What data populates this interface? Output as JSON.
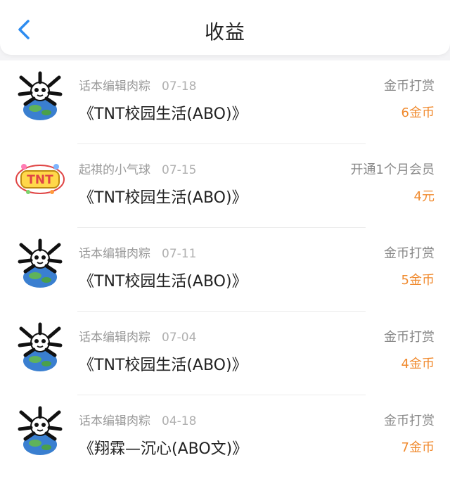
{
  "header": {
    "title": "收益",
    "back_icon": "chevron-left-icon",
    "accent": "#2d8cf0"
  },
  "colors": {
    "amount": "#f08a2e"
  },
  "rows": [
    {
      "user": "话本编辑肉粽",
      "date": "07-18",
      "book": "《TNT校园生活(ABO)》",
      "type": "金币打赏",
      "amount": "6金币",
      "avatar": "panda-globe-avatar"
    },
    {
      "user": "起祺的小气球",
      "date": "07-15",
      "book": "《TNT校园生活(ABO)》",
      "type": "开通1个月会员",
      "amount": "4元",
      "avatar": "tnt-sticker-avatar"
    },
    {
      "user": "话本编辑肉粽",
      "date": "07-11",
      "book": "《TNT校园生活(ABO)》",
      "type": "金币打赏",
      "amount": "5金币",
      "avatar": "panda-globe-avatar"
    },
    {
      "user": "话本编辑肉粽",
      "date": "07-04",
      "book": "《TNT校园生活(ABO)》",
      "type": "金币打赏",
      "amount": "4金币",
      "avatar": "panda-globe-avatar"
    },
    {
      "user": "话本编辑肉粽",
      "date": "04-18",
      "book": "《翔霖—沉心(ABO文)》",
      "type": "金币打赏",
      "amount": "7金币",
      "avatar": "panda-globe-avatar"
    }
  ]
}
